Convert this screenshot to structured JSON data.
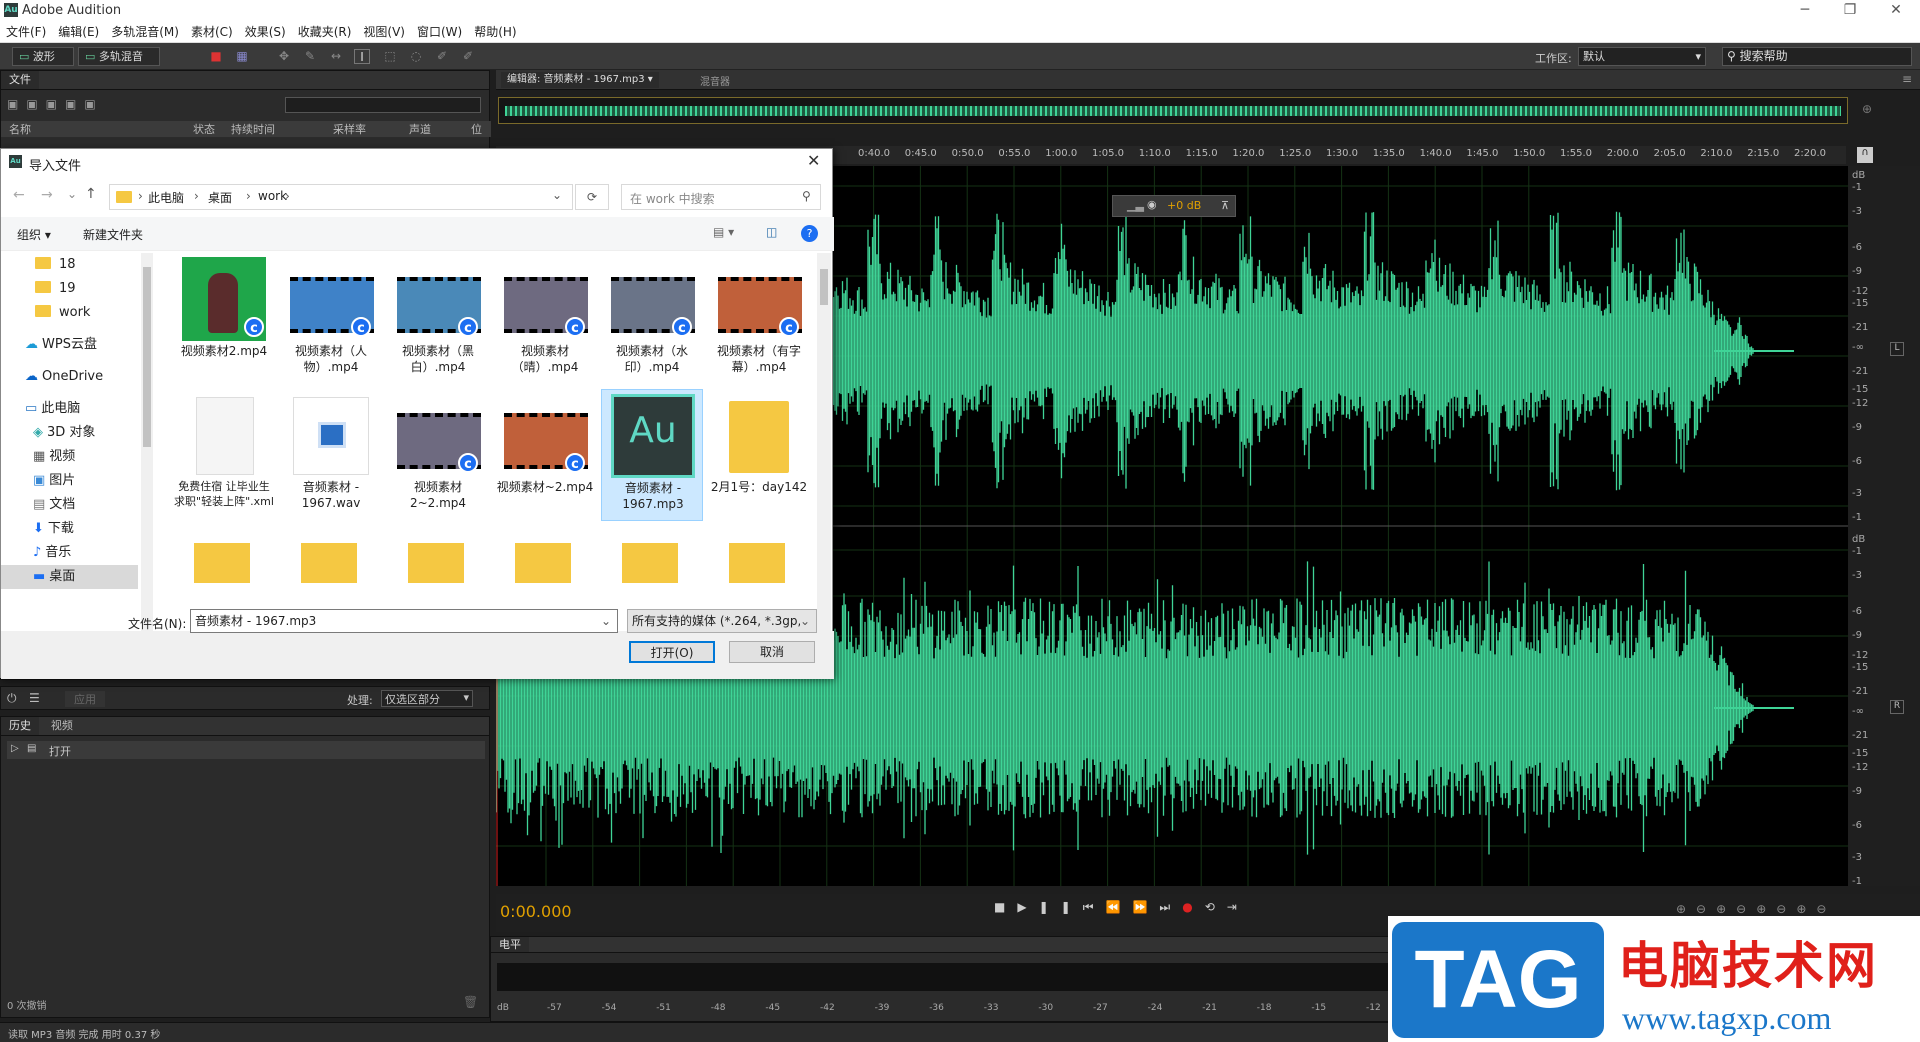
{
  "app": {
    "title": "Adobe Audition",
    "logo": "Au"
  },
  "menu": [
    "文件(F)",
    "编辑(E)",
    "多轨混音(M)",
    "素材(C)",
    "效果(S)",
    "收藏夹(R)",
    "视图(V)",
    "窗口(W)",
    "帮助(H)"
  ],
  "toolbar": {
    "waveform_label": "波形",
    "multitrack_label": "多轨混音",
    "workspace_label": "工作区:",
    "workspace_value": "默认",
    "search_help": "搜索帮助"
  },
  "files_panel": {
    "tab": "文件",
    "columns": [
      "名称",
      "状态",
      "持续时间",
      "采样率",
      "声道",
      "位"
    ]
  },
  "editor": {
    "tab_editor": "编辑器: 音频素材 - 1967.mp3",
    "tab_mixer": "混音器",
    "time": "0:00.000",
    "db_readout": "+0 dB"
  },
  "ruler_ticks": [
    "0:40.0",
    "0:45.0",
    "0:50.0",
    "0:55.0",
    "1:00.0",
    "1:05.0",
    "1:10.0",
    "1:15.0",
    "1:20.0",
    "1:25.0",
    "1:30.0",
    "1:35.0",
    "1:40.0",
    "1:45.0",
    "1:50.0",
    "1:55.0",
    "2:00.0",
    "2:05.0",
    "2:10.0",
    "2:15.0",
    "2:20.0"
  ],
  "db_scale_left": [
    "dB",
    "-1",
    "-3",
    "-6",
    "-9",
    "-12",
    "-15",
    "-21",
    "-∞",
    "-21",
    "-15",
    "-12",
    "-9",
    "-6",
    "-3",
    "-1"
  ],
  "db_scale_right": [
    "dB",
    "-1",
    "-3",
    "-6",
    "-9",
    "-12",
    "-15",
    "-21",
    "-∞",
    "-21",
    "-15",
    "-12",
    "-9",
    "-6",
    "-3",
    "-1"
  ],
  "channel_left": "L",
  "channel_right": "R",
  "effects_panel": {
    "apply": "应用",
    "process_label": "处理:",
    "process_value": "仅选区部分"
  },
  "history_panel": {
    "tab_history": "历史",
    "tab_video": "视频",
    "item": "打开",
    "undo_count": "0 次撤销"
  },
  "levels_panel": {
    "tab": "电平",
    "scale": [
      "dB",
      "-57",
      "-54",
      "-51",
      "-48",
      "-45",
      "-42",
      "-39",
      "-36",
      "-33",
      "-30",
      "-27",
      "-24",
      "-21",
      "-18",
      "-15",
      "-12"
    ]
  },
  "status_bar": "读取 MP3 音频 完成 用时 0.37 秒",
  "dialog": {
    "title": "导入文件",
    "breadcrumb": [
      "此电脑",
      "桌面",
      "work"
    ],
    "search_placeholder": "在 work 中搜索",
    "organize": "组织 ▾",
    "new_folder": "新建文件夹",
    "tree": [
      "18",
      "19",
      "work",
      "WPS云盘",
      "OneDrive",
      "此电脑",
      "3D 对象",
      "视频",
      "图片",
      "文档",
      "下载",
      "音乐",
      "桌面"
    ],
    "files_row1": [
      "视频素材2.mp4",
      "视频素材（人物）.mp4",
      "视频素材（黑白）.mp4",
      "视频素材（晴）.mp4",
      "视频素材（水印）.mp4",
      "视频素材（有字幕）.mp4"
    ],
    "files_row2": [
      "免费住宿  让毕业生求职\"轻装上阵\".xml",
      "音频素材 - 1967.wav",
      "视频素材2~2.mp4",
      "视频素材~2.mp4",
      "音频素材 - 1967.mp3",
      "2月1号：day142"
    ],
    "filename_label": "文件名(N):",
    "filename_value": "音频素材 - 1967.mp3",
    "filter_value": "所有支持的媒体 (*.264, *.3gp,",
    "open_button": "打开(O)",
    "cancel_button": "取消"
  },
  "watermark": {
    "tag": "TAG",
    "site_name": "电脑技术网",
    "url": "www.tagxp.com"
  },
  "colors": {
    "wave": "#3fd497",
    "accent_time": "#e0a000",
    "dialog_selected": "#cce8ff"
  }
}
